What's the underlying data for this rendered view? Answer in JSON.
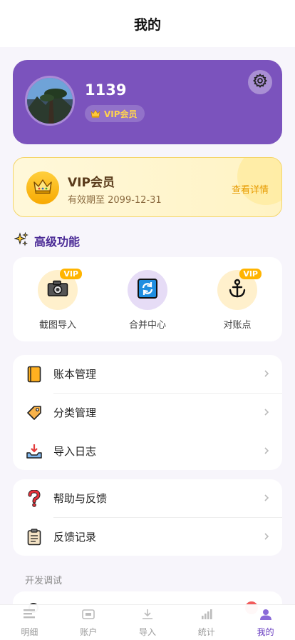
{
  "header": {
    "title": "我的"
  },
  "profile": {
    "username": "1139",
    "vip_badge_label": "VIP会员",
    "settings_icon": "gear-icon"
  },
  "vip_card": {
    "title": "VIP会员",
    "expiry": "有效期至 2099-12-31",
    "detail_link": "查看详情"
  },
  "features_section": {
    "title": "高级功能",
    "items": [
      {
        "label": "截图导入",
        "icon": "camera-icon",
        "badge": "VIP"
      },
      {
        "label": "合并中心",
        "icon": "sync-icon",
        "badge": ""
      },
      {
        "label": "对账点",
        "icon": "anchor-icon",
        "badge": "VIP"
      }
    ]
  },
  "menu_group_1": {
    "items": [
      {
        "label": "账本管理",
        "icon": "ledger-book-icon"
      },
      {
        "label": "分类管理",
        "icon": "tag-icon"
      },
      {
        "label": "导入日志",
        "icon": "inbox-tray-icon"
      }
    ]
  },
  "menu_group_2": {
    "items": [
      {
        "label": "帮助与反馈",
        "icon": "question-mark-icon"
      },
      {
        "label": "反馈记录",
        "icon": "clipboard-icon"
      }
    ]
  },
  "dev_section": {
    "label": "开发调试"
  },
  "tabbar": {
    "tabs": [
      {
        "label": "明细",
        "icon": "list-icon"
      },
      {
        "label": "账户",
        "icon": "wallet-icon"
      },
      {
        "label": "导入",
        "icon": "download-icon"
      },
      {
        "label": "统计",
        "icon": "bar-chart-icon"
      },
      {
        "label": "我的",
        "icon": "person-icon",
        "active": true
      }
    ]
  },
  "colors": {
    "brand_purple": "#7b53bd",
    "vip_gold": "#ffb400",
    "active_tab": "#6a3fc1"
  }
}
